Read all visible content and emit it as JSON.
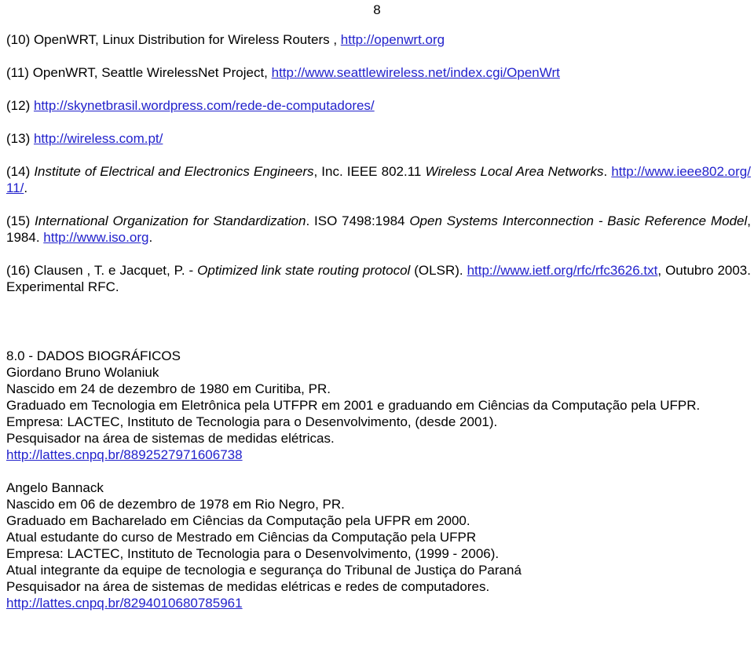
{
  "page": {
    "number": "8"
  },
  "references": [
    {
      "id": "ref-10",
      "label": "(10)",
      "text": " OpenWRT, Linux Distribution for Wireless Routers , ",
      "link": "http://openwrt.org",
      "trailing": ""
    },
    {
      "id": "ref-11",
      "label": "(11)",
      "text": " OpenWRT, Seattle WirelessNet Project, ",
      "link": "http://www.seattlewireless.net/index.cgi/OpenWrt",
      "trailing": ""
    },
    {
      "id": "ref-12",
      "label": "(12)",
      "text": " ",
      "link": "http://skynetbrasil.wordpress.com/rede-de-computadores/",
      "trailing": ""
    },
    {
      "id": "ref-13",
      "label": "(13)",
      "text": " ",
      "link": "http://wireless.com.pt/",
      "trailing": ""
    },
    {
      "id": "ref-14",
      "label": "(14)",
      "italic_1": " Institute of Electrical and Electronics Engineers",
      "text": ", Inc. IEEE 802.11 ",
      "italic_2": "Wireless Local Area Networks",
      "text_2": ". ",
      "link": "http://www.ieee802.org/11/",
      "trailing": "."
    },
    {
      "id": "ref-15",
      "label": "(15)",
      "italic_1": " International Organization for Standardization",
      "text": ". ISO 7498:1984 ",
      "italic_2": "Open Systems Interconnection - Basic Reference Model",
      "text_2": ", 1984. ",
      "link": "http://www.iso.org",
      "trailing": "."
    },
    {
      "id": "ref-16",
      "label": "(16)",
      "text": " Clausen , T. e Jacquet, P. - ",
      "italic_1": "Optimized link state routing protocol",
      "text_2": " (OLSR). ",
      "link": "http://www.ietf.org/rfc/rfc3626.txt",
      "trailing": ", Outubro 2003. Experimental RFC."
    }
  ],
  "bio_section": {
    "heading": "8.0 - DADOS BIOGRÁFICOS",
    "person_1": {
      "name": "Giordano Bruno Wolaniuk",
      "birth": "Nascido em 24 de dezembro de 1980 em Curitiba, PR.",
      "education": "Graduado em Tecnologia em Eletrônica pela UTFPR em 2001 e graduando em Ciências da Computação pela UFPR.",
      "company": "Empresa: LACTEC, Instituto de Tecnologia para o Desenvolvimento, (desde 2001).",
      "research": "Pesquisador na área de sistemas de medidas elétricas.",
      "lattes": "http://lattes.cnpq.br/8892527971606738"
    },
    "person_2": {
      "name": "Angelo Bannack",
      "birth": "Nascido em 06 de dezembro de 1978 em Rio Negro, PR.",
      "education": "Graduado em Bacharelado em Ciências da Computação pela UFPR em 2000.",
      "current_study": "Atual estudante do curso de Mestrado em Ciências da Computação pela UFPR",
      "company": "Empresa: LACTEC, Instituto de Tecnologia para o Desenvolvimento, (1999 - 2006).",
      "current_role": "Atual integrante da equipe de tecnologia e segurança do Tribunal de Justiça do Paraná",
      "research": "Pesquisador na área de sistemas de medidas elétricas e redes de computadores.",
      "lattes": "http://lattes.cnpq.br/8294010680785961"
    }
  },
  "colors": {
    "link": "#2222cc",
    "text": "#000000",
    "background": "#ffffff"
  }
}
